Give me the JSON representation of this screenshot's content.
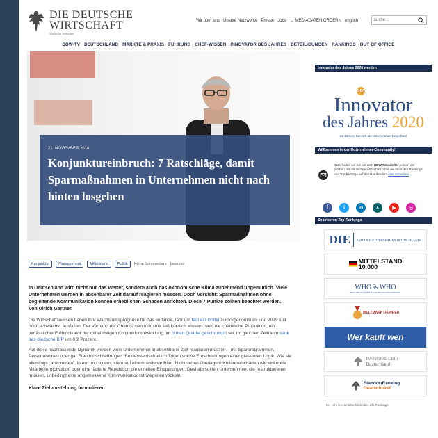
{
  "site": {
    "logo_line1": "DIE DEUTSCHE",
    "logo_line2": "WIRTSCHAFT",
    "logo_sub": "Wissen für Wirtschaft"
  },
  "toplinks": [
    "Wir über uns",
    "Unsere Netzwerke",
    "Presse",
    "Jobs",
    "→ MEDIADATEN ORDERN",
    "english"
  ],
  "search": {
    "placeholder": "Suche ..."
  },
  "nav": [
    "DDW-TV",
    "DEUTSCHLAND",
    "MÄRKTE & PRAXIS",
    "FÜHRUNG",
    "CHEF-WISSEN",
    "INNOVATOR DES JAHRES",
    "BETEILIGUNGEN",
    "RANKINGS",
    "OUT OF OFFICE"
  ],
  "hero": {
    "date": "21. NOVEMBER 2018",
    "title": "Konjunktureinbruch: 7 Ratschläge, damit Sparmaßnahmen in Unternehmen nicht nach hinten losgehen"
  },
  "tags": [
    "Konjunktur",
    "Management",
    "Mittelstand",
    "Politik"
  ],
  "meta": {
    "comments": "Keine Kommentare",
    "readtime": "Lesezeit"
  },
  "article": {
    "lead": "In Deutschland wird nicht nur das Wetter, sondern auch das ökonomische Klima zunehmend ungemütlich. Viele Unternehmen werden in absehbarer Zeit darauf reagieren müssen. Doch Vorsicht: Sparmaßnahmen ohne begleitende Kommunikation können erheblichen Schaden anrichten. Diese 7 Punkte sollten beachtet werden. Von Ulrich Gartner.",
    "p1_a": "Die Wirtschaftsweisen haben ihre Wachstumsprognose für das laufende Jahr um ",
    "p1_link1": "fast ein Drittel",
    "p1_b": " zurückgenommen, und 2019 soll noch schwächer ausfallen. Der Verband der Chemischen Industrie ließ kürzlich wissen, dass die chemische Produktion, ein verlässlicher Frühindikator der mittelfristigen Konjunkturentwicklung, im ",
    "p1_link2": "dritten Quartal geschrumpft",
    "p1_c": " sei. Im gleichen Zeitraum ",
    "p1_link3": "sank das deutsche BIP",
    "p1_d": " um 0,2 Prozent.",
    "p2": "Auf diese nachlassende Dynamik werden viele Unternehmen in absehbarer Zeit reagieren müssen – mit Sparprogrammen, Personalabbau oder gar Standortschließungen. Betriebswirtschaftlich folgen solche Entscheidungen einer glasklaren Logik. Wie sie allerdings „ankommen\", intern und extern, steht auf einem anderen Blatt. Nicht selten überlagern Kollateralschäden wie sinkende Mitarbeitermotivation oder eine lädierte Reputation die erzielten Einsparungen. Deshalb sollten Unternehmen, die restrukturieren müssen, unbedingt eine angemessene Kommunikationsstrategie entwickeln.",
    "subhead": "Klare Zielvorstellung formulieren"
  },
  "sidebar": {
    "innov_header": "Innovator des Jahres 2020 werden",
    "innov_badge": "DDW",
    "innov_t1": "Innovator",
    "innov_t2": "des Jahres",
    "innov_year": "2020",
    "innov_sub": "So können Sie sich als Unternehmen bewerben!",
    "comm_header": "Willkommen in der Unternehmer-Community!",
    "comm_a": "Gern halten wir Sie mit dem ",
    "comm_b": "DDW-Newsletter",
    "comm_c": ", einem der größten der deutschen Wirtschaft, über die neuesten Rankings und Top-Beiträge auf dem Laufenden: ",
    "comm_link": "Hier anmelden",
    "socials": [
      {
        "name": "facebook",
        "glyph": "f",
        "color": "#3b5998"
      },
      {
        "name": "twitter",
        "glyph": "t",
        "color": "#1da1f2"
      },
      {
        "name": "linkedin",
        "glyph": "in",
        "color": "#0077b5"
      },
      {
        "name": "xing",
        "glyph": "x",
        "color": "#026466"
      },
      {
        "name": "youtube",
        "glyph": "▶",
        "color": "#e62117"
      },
      {
        "name": "instagram",
        "glyph": "◎",
        "color": "#d6249f"
      }
    ],
    "rank_header": "Zu unseren Top-Rankings",
    "r_die_big": "DIE",
    "r_die_small": "FAMILIEN UNTERNEHMEN DEUTSCHLANDS",
    "r_mittel1": "MITTELSTAND",
    "r_mittel2": "10.000",
    "r_who1": "WHO is WHO",
    "r_who2": "DER DEUTSCHEN FAMILIENUNTERNEHMEN",
    "r_welt": "WELTMARKTFÜHRER",
    "r_wer": "Wer kauft wen",
    "r_inv1": "Investoren-Liste",
    "r_inv2": "Deutschland",
    "r_std1": "StandortRanking",
    "r_std2": "Deutschland",
    "foot": "Hier zum Gesamtüberblick über alle Rankings"
  }
}
